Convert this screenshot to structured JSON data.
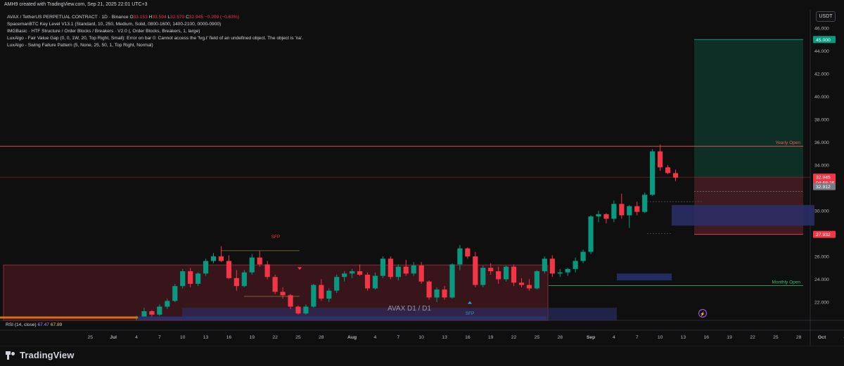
{
  "header": {
    "credit": "AMH9 created with TradingView.com, Sep 21, 2025 22:01 UTC+3",
    "currency": "USDT"
  },
  "legend": {
    "symbol": "AVAX / TetherUS PERPETUAL CONTRACT · 1D · Binance",
    "o_label": "O",
    "o_value": "33.153",
    "h_label": "H",
    "h_value": "33.594",
    "l_label": "L",
    "l_value": "32.570",
    "c_label": "C",
    "c_value": "32.945",
    "change": "−0.209 (−0.63%)",
    "indicators": [
      "SpacemanBTC Key Level V13.1 (Standard, 10, 250, Medium, Solid, 0800-1600, 1400-2100, 0000-0900)",
      "IMGBasic · HTF Structure / Order Blocks / Breakers · V2.0 (, Order Blocks, Breakers, 1, large)",
      "LuxAlgo - Fair Value Gap (0, 0, 1W, 20, Top Right, Small): Error on bar 0: Cannot access the 'fvg.t' field of an undefined object. The object is 'na'.",
      "LuxAlgo - Swing Failure Pattern (5, None, 25, 50, 1, Top Right, Normal)"
    ]
  },
  "rsi": {
    "label": "RSI (14, close)",
    "value1": "67.47",
    "value2": "67.89"
  },
  "footer": {
    "brand": "TradingView"
  },
  "chart_data": {
    "type": "candlestick",
    "title": "AVAX / TetherUS PERPETUAL CONTRACT · 1D · Binance",
    "watermark": "AVAX D1 / D1",
    "ylim": [
      20.4,
      47.6
    ],
    "y_ticks": [
      22,
      24,
      26,
      28,
      30,
      32,
      34,
      36,
      38,
      40,
      42,
      44,
      46
    ],
    "x_ticks": [
      {
        "label": "25",
        "i": -6
      },
      {
        "label": "Jul",
        "i": -3
      },
      {
        "label": "4",
        "i": 0
      },
      {
        "label": "7",
        "i": 3
      },
      {
        "label": "10",
        "i": 6
      },
      {
        "label": "13",
        "i": 9
      },
      {
        "label": "16",
        "i": 12
      },
      {
        "label": "19",
        "i": 15
      },
      {
        "label": "22",
        "i": 18
      },
      {
        "label": "25",
        "i": 21
      },
      {
        "label": "28",
        "i": 24
      },
      {
        "label": "Aug",
        "i": 28
      },
      {
        "label": "4",
        "i": 31
      },
      {
        "label": "7",
        "i": 34
      },
      {
        "label": "10",
        "i": 37
      },
      {
        "label": "13",
        "i": 40
      },
      {
        "label": "16",
        "i": 43
      },
      {
        "label": "19",
        "i": 46
      },
      {
        "label": "22",
        "i": 49
      },
      {
        "label": "25",
        "i": 52
      },
      {
        "label": "28",
        "i": 55
      },
      {
        "label": "Sep",
        "i": 59
      },
      {
        "label": "4",
        "i": 62
      },
      {
        "label": "7",
        "i": 65
      },
      {
        "label": "10",
        "i": 68
      },
      {
        "label": "13",
        "i": 71
      },
      {
        "label": "16",
        "i": 74
      },
      {
        "label": "19",
        "i": 77
      },
      {
        "label": "22",
        "i": 80
      },
      {
        "label": "25",
        "i": 83
      },
      {
        "label": "28",
        "i": 86
      },
      {
        "label": "Oct",
        "i": 89
      },
      {
        "label": "4",
        "i": 92
      }
    ],
    "candles": [
      [
        20.6,
        20.8,
        20.4,
        20.7
      ],
      [
        20.7,
        21.5,
        20.6,
        21.2
      ],
      [
        21.2,
        21.3,
        20.7,
        20.9
      ],
      [
        20.9,
        21.8,
        20.8,
        21.6
      ],
      [
        21.6,
        22.3,
        21.4,
        22.1
      ],
      [
        22.1,
        23.6,
        22.0,
        23.4
      ],
      [
        23.4,
        24.9,
        23.2,
        24.7
      ],
      [
        24.7,
        25.0,
        23.3,
        23.6
      ],
      [
        23.6,
        24.6,
        23.4,
        24.5
      ],
      [
        24.5,
        25.8,
        24.3,
        25.6
      ],
      [
        25.6,
        26.3,
        25.4,
        26.0
      ],
      [
        26.0,
        26.9,
        25.5,
        25.6
      ],
      [
        25.6,
        26.1,
        24.0,
        24.1
      ],
      [
        24.1,
        24.8,
        23.0,
        23.4
      ],
      [
        23.4,
        24.8,
        23.3,
        24.6
      ],
      [
        24.6,
        26.2,
        24.4,
        25.9
      ],
      [
        25.9,
        26.5,
        25.1,
        25.3
      ],
      [
        25.3,
        25.6,
        24.0,
        24.2
      ],
      [
        24.2,
        24.4,
        22.7,
        22.9
      ],
      [
        22.9,
        23.3,
        22.3,
        22.6
      ],
      [
        22.6,
        22.7,
        21.4,
        21.6
      ],
      [
        21.6,
        21.7,
        20.9,
        21.0
      ],
      [
        21.0,
        21.8,
        20.9,
        21.6
      ],
      [
        21.6,
        23.6,
        21.5,
        23.5
      ],
      [
        23.5,
        24.0,
        22.1,
        22.3
      ],
      [
        22.3,
        23.2,
        22.0,
        23.0
      ],
      [
        23.0,
        24.4,
        22.8,
        24.2
      ],
      [
        24.2,
        24.7,
        23.8,
        24.5
      ],
      [
        24.5,
        24.9,
        24.1,
        24.7
      ],
      [
        24.7,
        25.3,
        24.3,
        24.4
      ],
      [
        24.4,
        24.6,
        23.0,
        23.2
      ],
      [
        23.2,
        24.6,
        23.1,
        24.3
      ],
      [
        24.3,
        26.0,
        24.1,
        25.8
      ],
      [
        25.8,
        26.0,
        24.0,
        24.2
      ],
      [
        24.2,
        25.3,
        23.9,
        25.1
      ],
      [
        25.1,
        25.7,
        24.3,
        24.5
      ],
      [
        24.5,
        25.5,
        24.3,
        25.2
      ],
      [
        25.2,
        25.5,
        23.6,
        23.8
      ],
      [
        23.8,
        23.9,
        22.2,
        22.4
      ],
      [
        22.4,
        23.3,
        22.0,
        23.1
      ],
      [
        23.1,
        23.4,
        22.2,
        22.4
      ],
      [
        22.4,
        25.4,
        22.3,
        25.3
      ],
      [
        25.3,
        27.0,
        24.8,
        26.7
      ],
      [
        26.7,
        26.8,
        25.8,
        26.0
      ],
      [
        26.0,
        26.4,
        23.3,
        23.5
      ],
      [
        23.5,
        25.2,
        23.3,
        25.0
      ],
      [
        25.0,
        25.4,
        24.4,
        24.7
      ],
      [
        24.7,
        25.1,
        23.6,
        24.0
      ],
      [
        24.0,
        25.2,
        23.8,
        25.1
      ],
      [
        25.1,
        25.3,
        23.4,
        23.7
      ],
      [
        23.7,
        24.1,
        23.3,
        23.5
      ],
      [
        23.5,
        24.0,
        23.0,
        23.2
      ],
      [
        23.2,
        24.8,
        23.1,
        24.7
      ],
      [
        24.7,
        26.0,
        24.5,
        25.8
      ],
      [
        25.8,
        26.1,
        24.2,
        24.5
      ],
      [
        24.5,
        24.9,
        24.2,
        24.6
      ],
      [
        24.6,
        25.0,
        24.3,
        24.9
      ],
      [
        24.9,
        25.9,
        24.6,
        25.6
      ],
      [
        25.6,
        26.6,
        25.4,
        26.4
      ],
      [
        26.4,
        29.6,
        26.2,
        29.5
      ],
      [
        29.5,
        30.0,
        29.0,
        29.7
      ],
      [
        29.7,
        29.8,
        28.9,
        29.3
      ],
      [
        29.3,
        30.9,
        29.0,
        30.6
      ],
      [
        30.6,
        31.5,
        29.3,
        29.6
      ],
      [
        29.6,
        30.5,
        28.5,
        30.4
      ],
      [
        30.4,
        30.8,
        29.6,
        29.9
      ],
      [
        29.9,
        31.6,
        29.8,
        31.4
      ],
      [
        31.4,
        35.4,
        31.3,
        35.2
      ],
      [
        35.2,
        35.8,
        33.5,
        33.8
      ],
      [
        33.8,
        34.0,
        33.2,
        33.3
      ],
      [
        33.3,
        33.6,
        32.6,
        32.9
      ]
    ],
    "levels": [
      {
        "name": "Yearly Open",
        "value": 35.65
      },
      {
        "name": "Monthly Open",
        "value": 23.44
      }
    ],
    "price_labels": [
      {
        "value": 45.0,
        "text": "45.000",
        "color": "#089981"
      },
      {
        "value": 32.945,
        "text": "32.945",
        "sub": "04:58:26",
        "color": "#f23645"
      },
      {
        "value": 32.112,
        "text": "32.912",
        "color": "#787b86"
      },
      {
        "value": 27.932,
        "text": "27.932",
        "color": "#f23645"
      }
    ],
    "annotations": [
      "SFP",
      "SFP",
      "Yearly Open",
      "Monthly Open"
    ],
    "rsi_values": [
      67.47,
      67.89
    ]
  }
}
